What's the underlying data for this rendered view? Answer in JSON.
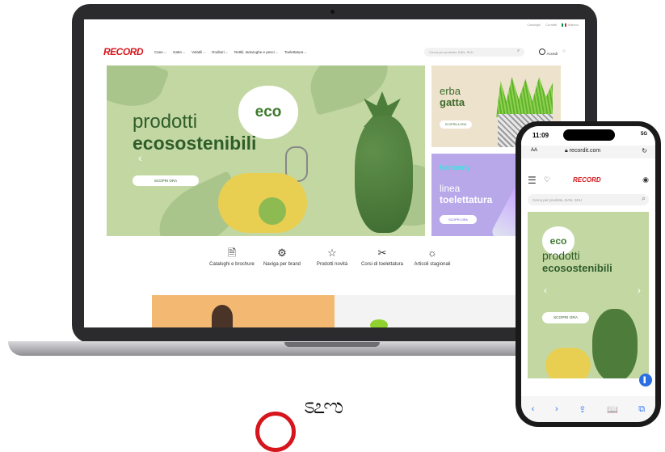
{
  "laptop": {
    "util_links": [
      "Cataloghi",
      "Contatti",
      "Italiano"
    ],
    "logo": "RECORD",
    "nav_items": [
      "Cane",
      "Gatto",
      "Volatili",
      "Roditori",
      "Rettili, tartarughe e pesci",
      "Toelettatura"
    ],
    "search_placeholder": "Cerca per prodotto, EAN, SKU",
    "account_label": "Accedi",
    "hero": {
      "title_line1": "prodotti",
      "title_line2": "ecosostenibili",
      "button": "SCOPRI ORA",
      "badge": "eco"
    },
    "promo_grass": {
      "line1": "erba",
      "line2": "gatta",
      "button": "SCOPRILA ORA"
    },
    "promo_grooming": {
      "brand": "harmony",
      "line1": "linea",
      "line2": "toelettatura",
      "button": "SCOPRI ORA"
    },
    "categories": [
      {
        "icon": "catalog-icon",
        "glyph": "🗎",
        "label": "Cataloghi e brochure"
      },
      {
        "icon": "award-icon",
        "glyph": "⚙",
        "label": "Naviga per brand"
      },
      {
        "icon": "star-icon",
        "glyph": "☆",
        "label": "Prodotti novità"
      },
      {
        "icon": "scissors-icon",
        "glyph": "✂",
        "label": "Corsi di toelettatura"
      },
      {
        "icon": "weather-icon",
        "glyph": "☼",
        "label": "Articoli stagionali"
      }
    ]
  },
  "phone": {
    "time": "11:09",
    "signal": "5G",
    "aa": "AA",
    "url": "recordit.com",
    "logo": "RECORD",
    "search_placeholder": "Cerca per prodotto, EAN, SKU",
    "hero": {
      "badge": "eco",
      "title_line1": "prodotti",
      "title_line2": "ecosostenibili",
      "button": "SCOPRI ORA"
    },
    "toolbar": [
      "‹",
      "›",
      "⇪",
      "📖",
      "⧉"
    ]
  },
  "colors": {
    "brand_red": "#d6161c",
    "eco_green": "#2f5d2a",
    "hero_bg": "#c3d7a3",
    "grooming_purple": "#b8a8ea"
  }
}
